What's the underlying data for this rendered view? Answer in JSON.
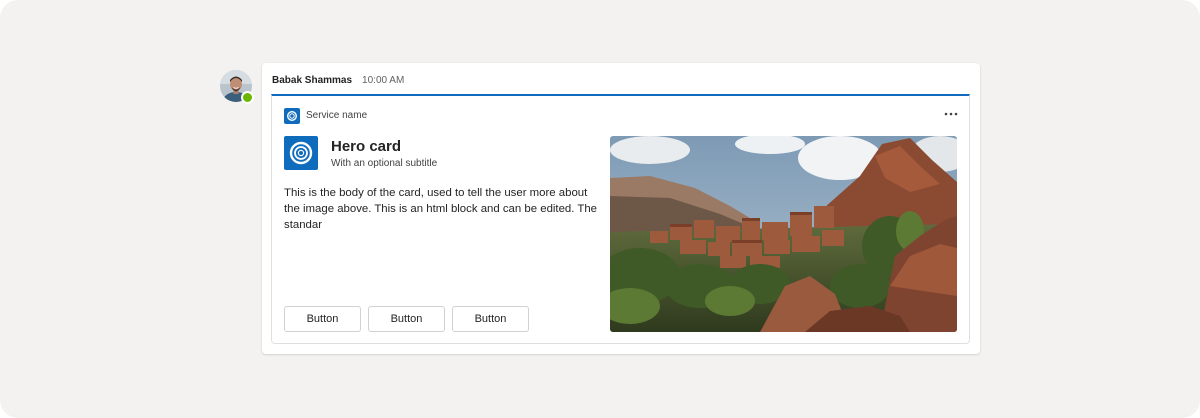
{
  "message": {
    "author": "Babak Shammas",
    "time": "10:00 AM",
    "presence_color": "#6bb700",
    "avatar_icon": "person-avatar"
  },
  "card": {
    "accent_color": "#0f6cbd",
    "service_icon": "service-ring-icon",
    "service_name": "Service name",
    "more_icon": "more-horizontal-icon",
    "hero_icon": "hero-ring-icon",
    "title": "Hero card",
    "subtitle": "With an optional subtitle",
    "body": "This is the body of the card, used to tell the user more about the image above. This is an html block and can be edited. The standar",
    "image": "mountain-village-photo",
    "buttons": [
      {
        "label": "Button"
      },
      {
        "label": "Button"
      },
      {
        "label": "Button"
      }
    ]
  }
}
